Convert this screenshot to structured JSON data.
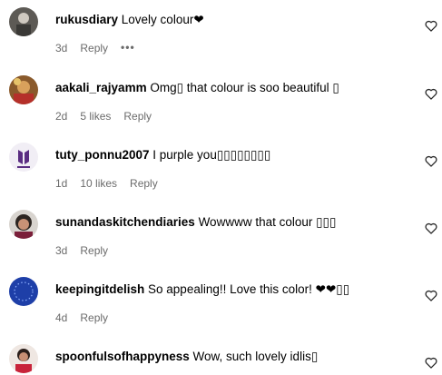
{
  "comments": [
    {
      "username": "rukusdiary",
      "text": " Lovely colour❤",
      "time": "3d",
      "likes": "",
      "reply": "Reply",
      "more": "•••"
    },
    {
      "username": "aakali_rajyamm",
      "text": " Omg▯ that colour is soo beautiful ▯",
      "time": "2d",
      "likes": "5 likes",
      "reply": "Reply",
      "more": ""
    },
    {
      "username": "tuty_ponnu2007",
      "text": " I purple you▯▯▯▯▯▯▯▯",
      "time": "1d",
      "likes": "10 likes",
      "reply": "Reply",
      "more": ""
    },
    {
      "username": "sunandaskitchendiaries",
      "text": " Wowwww that colour ▯▯▯",
      "time": "3d",
      "likes": "",
      "reply": "Reply",
      "more": ""
    },
    {
      "username": "keepingitdelish",
      "text": " So appealing!! Love this color! ❤❤▯▯",
      "time": "4d",
      "likes": "",
      "reply": "Reply",
      "more": ""
    },
    {
      "username": "spoonfulsofhappyness",
      "text": " Wow, such lovely idlis▯",
      "time": "",
      "likes": "",
      "reply": "",
      "more": ""
    }
  ],
  "colors": {
    "meta_text": "#6b6b6b",
    "heart_outline": "#262626"
  },
  "icons": {
    "like": "heart-outline-icon",
    "more": "ellipsis-icon"
  }
}
